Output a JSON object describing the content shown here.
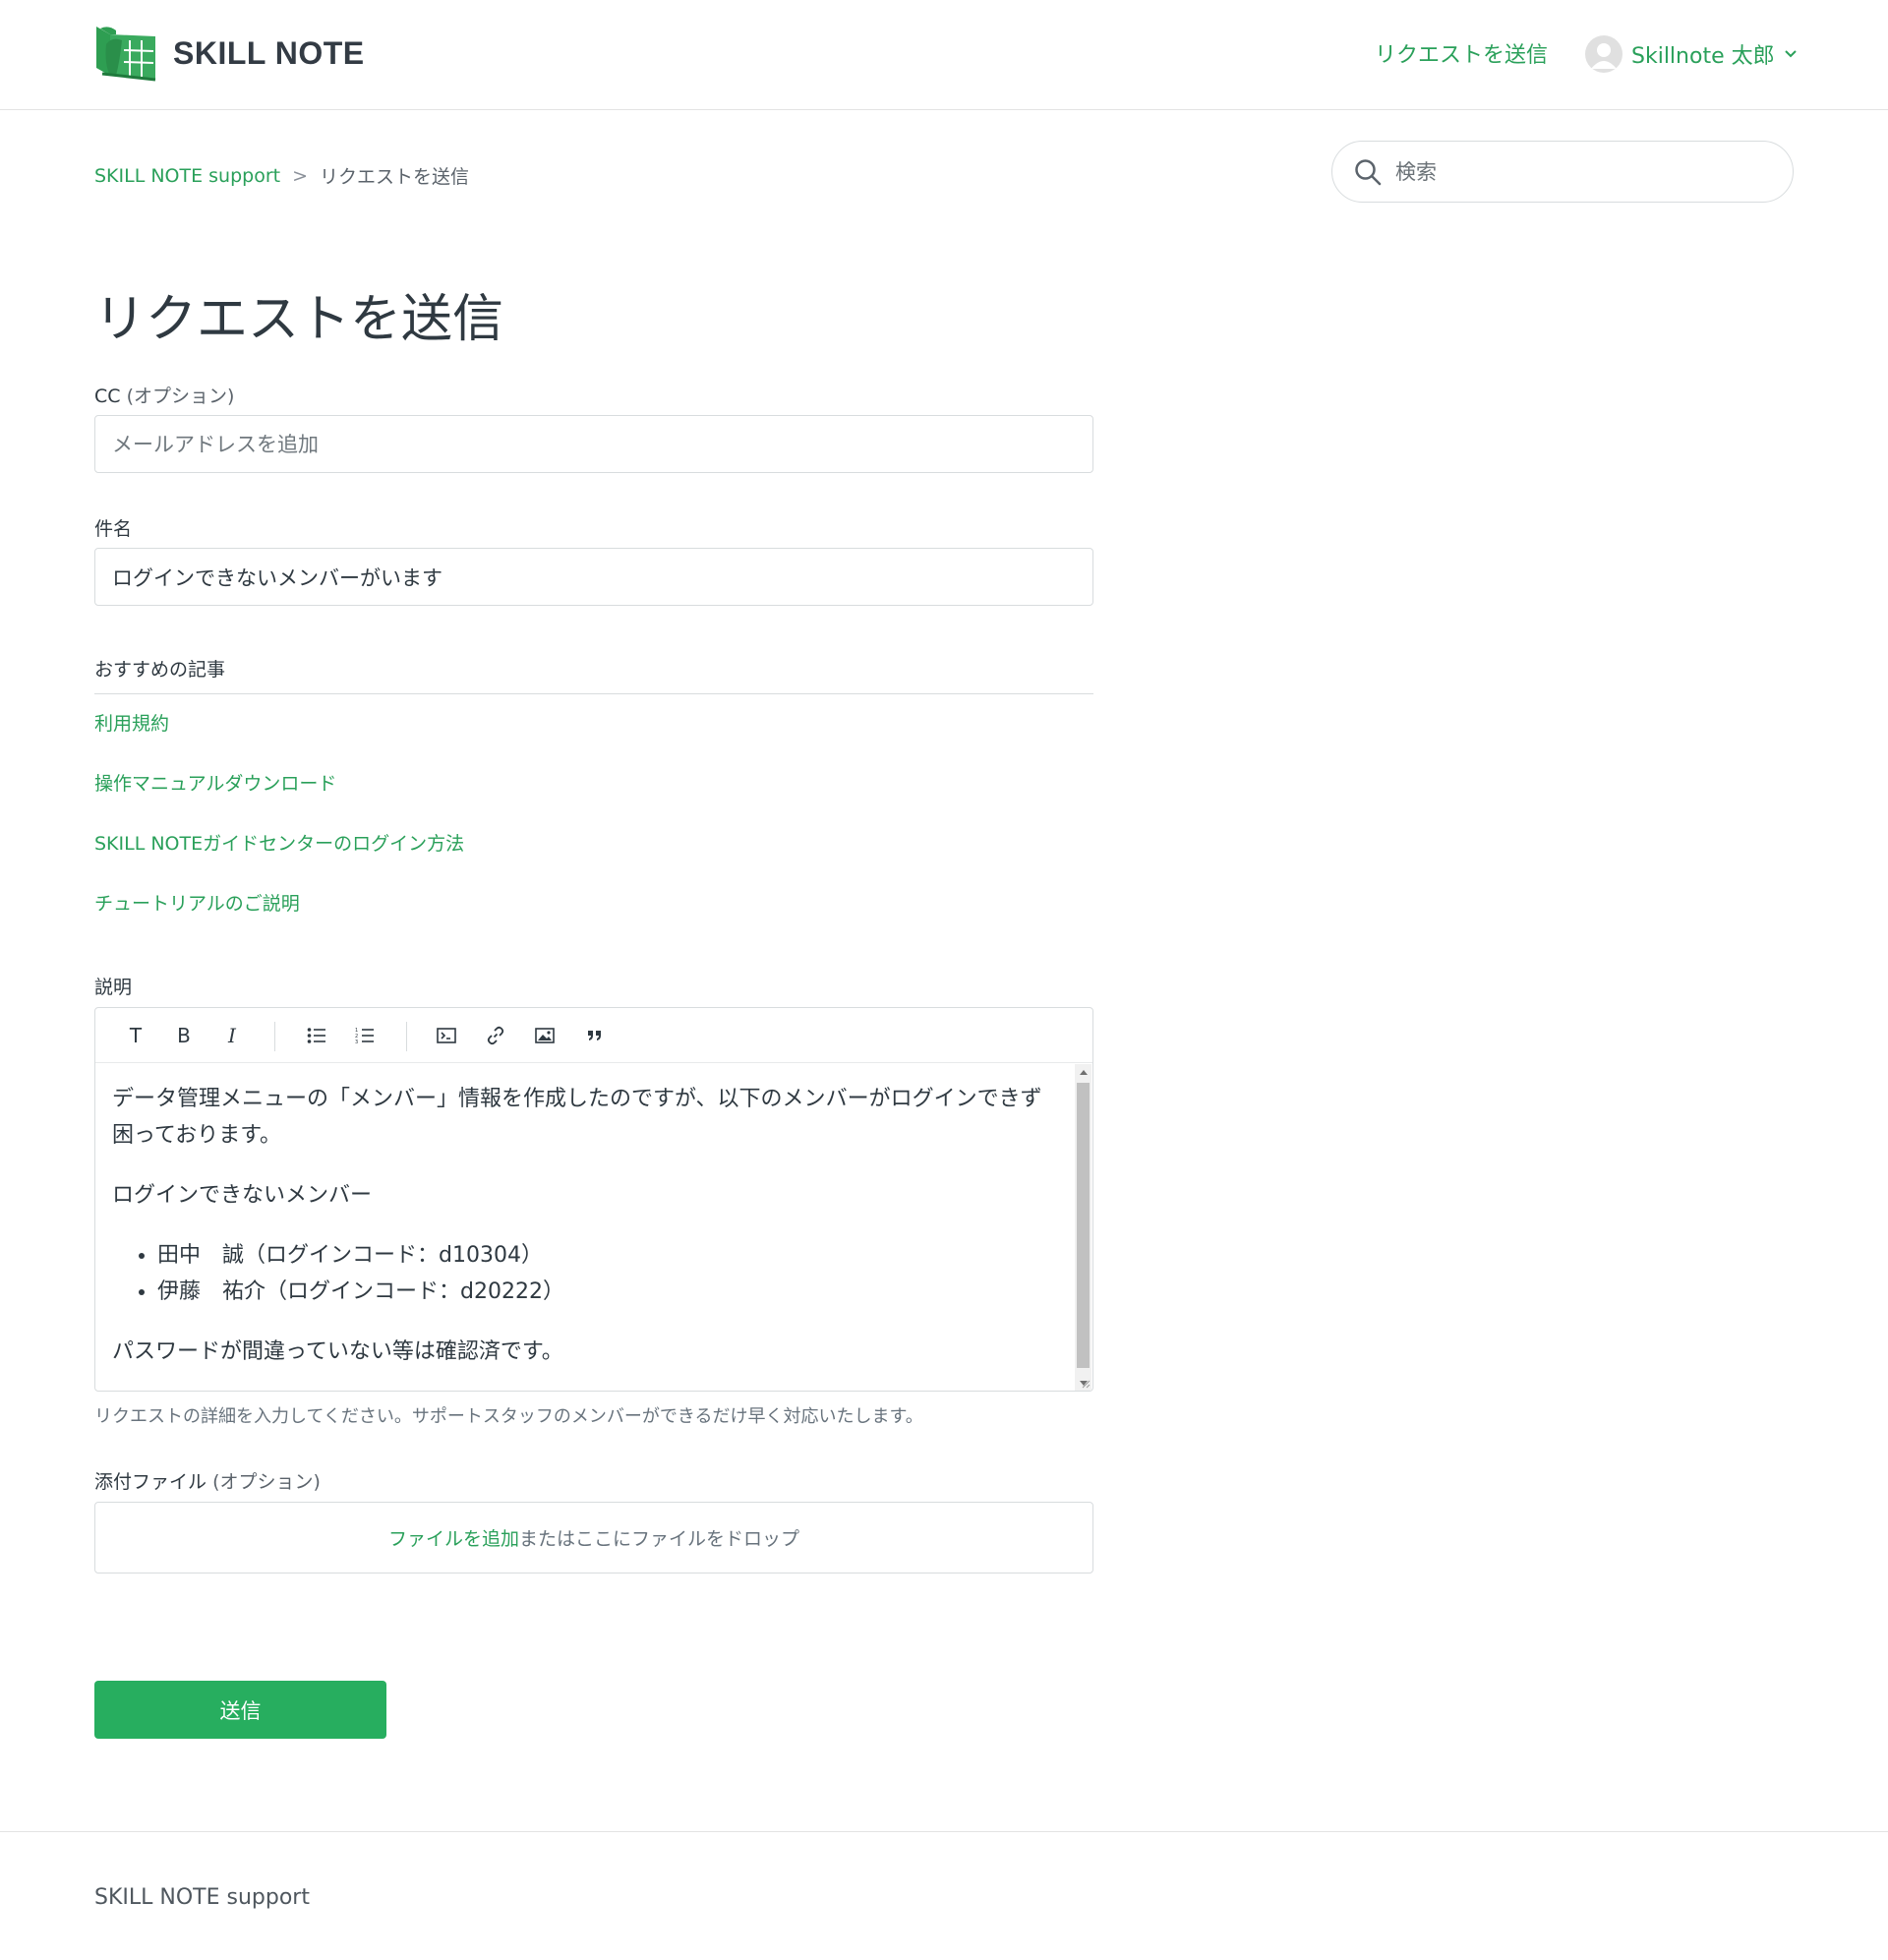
{
  "header": {
    "logo_text": "SKILL NOTE",
    "submit_request_link": "リクエストを送信",
    "user_name": "Skillnote 太郎"
  },
  "breadcrumb": {
    "home": "SKILL NOTE support",
    "separator": ">",
    "current": "リクエストを送信"
  },
  "search": {
    "placeholder": "検索"
  },
  "page": {
    "title": "リクエストを送信"
  },
  "form": {
    "cc": {
      "label": "CC",
      "optional": "(オプション)",
      "placeholder": "メールアドレスを追加"
    },
    "subject": {
      "label": "件名",
      "value": "ログインできないメンバーがいます"
    },
    "recommended": {
      "heading": "おすすめの記事",
      "articles": [
        "利用規約",
        "操作マニュアルダウンロード",
        "SKILL NOTEガイドセンターのログイン方法",
        "チュートリアルのご説明"
      ]
    },
    "description": {
      "label": "説明",
      "toolbar": [
        "T",
        "B",
        "I",
        "bulleted-list-icon",
        "numbered-list-icon",
        "code-block-icon",
        "link-icon",
        "image-icon",
        "quote-icon"
      ],
      "content": {
        "paragraph1": "データ管理メニューの「メンバー」情報を作成したのですが、以下のメンバーがログインできず困っております。",
        "paragraph2": "ログインできないメンバー",
        "list": [
          "田中　誠（ログインコード：d10304）",
          "伊藤　祐介（ログインコード：d20222）"
        ],
        "paragraph3": "パスワードが間違っていない等は確認済です。"
      },
      "hint": "リクエストの詳細を入力してください。サポートスタッフのメンバーができるだけ早く対応いたします。"
    },
    "attachments": {
      "label": "添付ファイル",
      "optional": "(オプション)",
      "add_link": "ファイルを追加",
      "drop_text": "またはここにファイルをドロップ"
    },
    "submit_label": "送信"
  },
  "footer": {
    "text": "SKILL NOTE support"
  },
  "colors": {
    "accent": "#2aa05a",
    "button": "#27ae5f",
    "text": "#2f3941",
    "border": "#d8dcde"
  }
}
